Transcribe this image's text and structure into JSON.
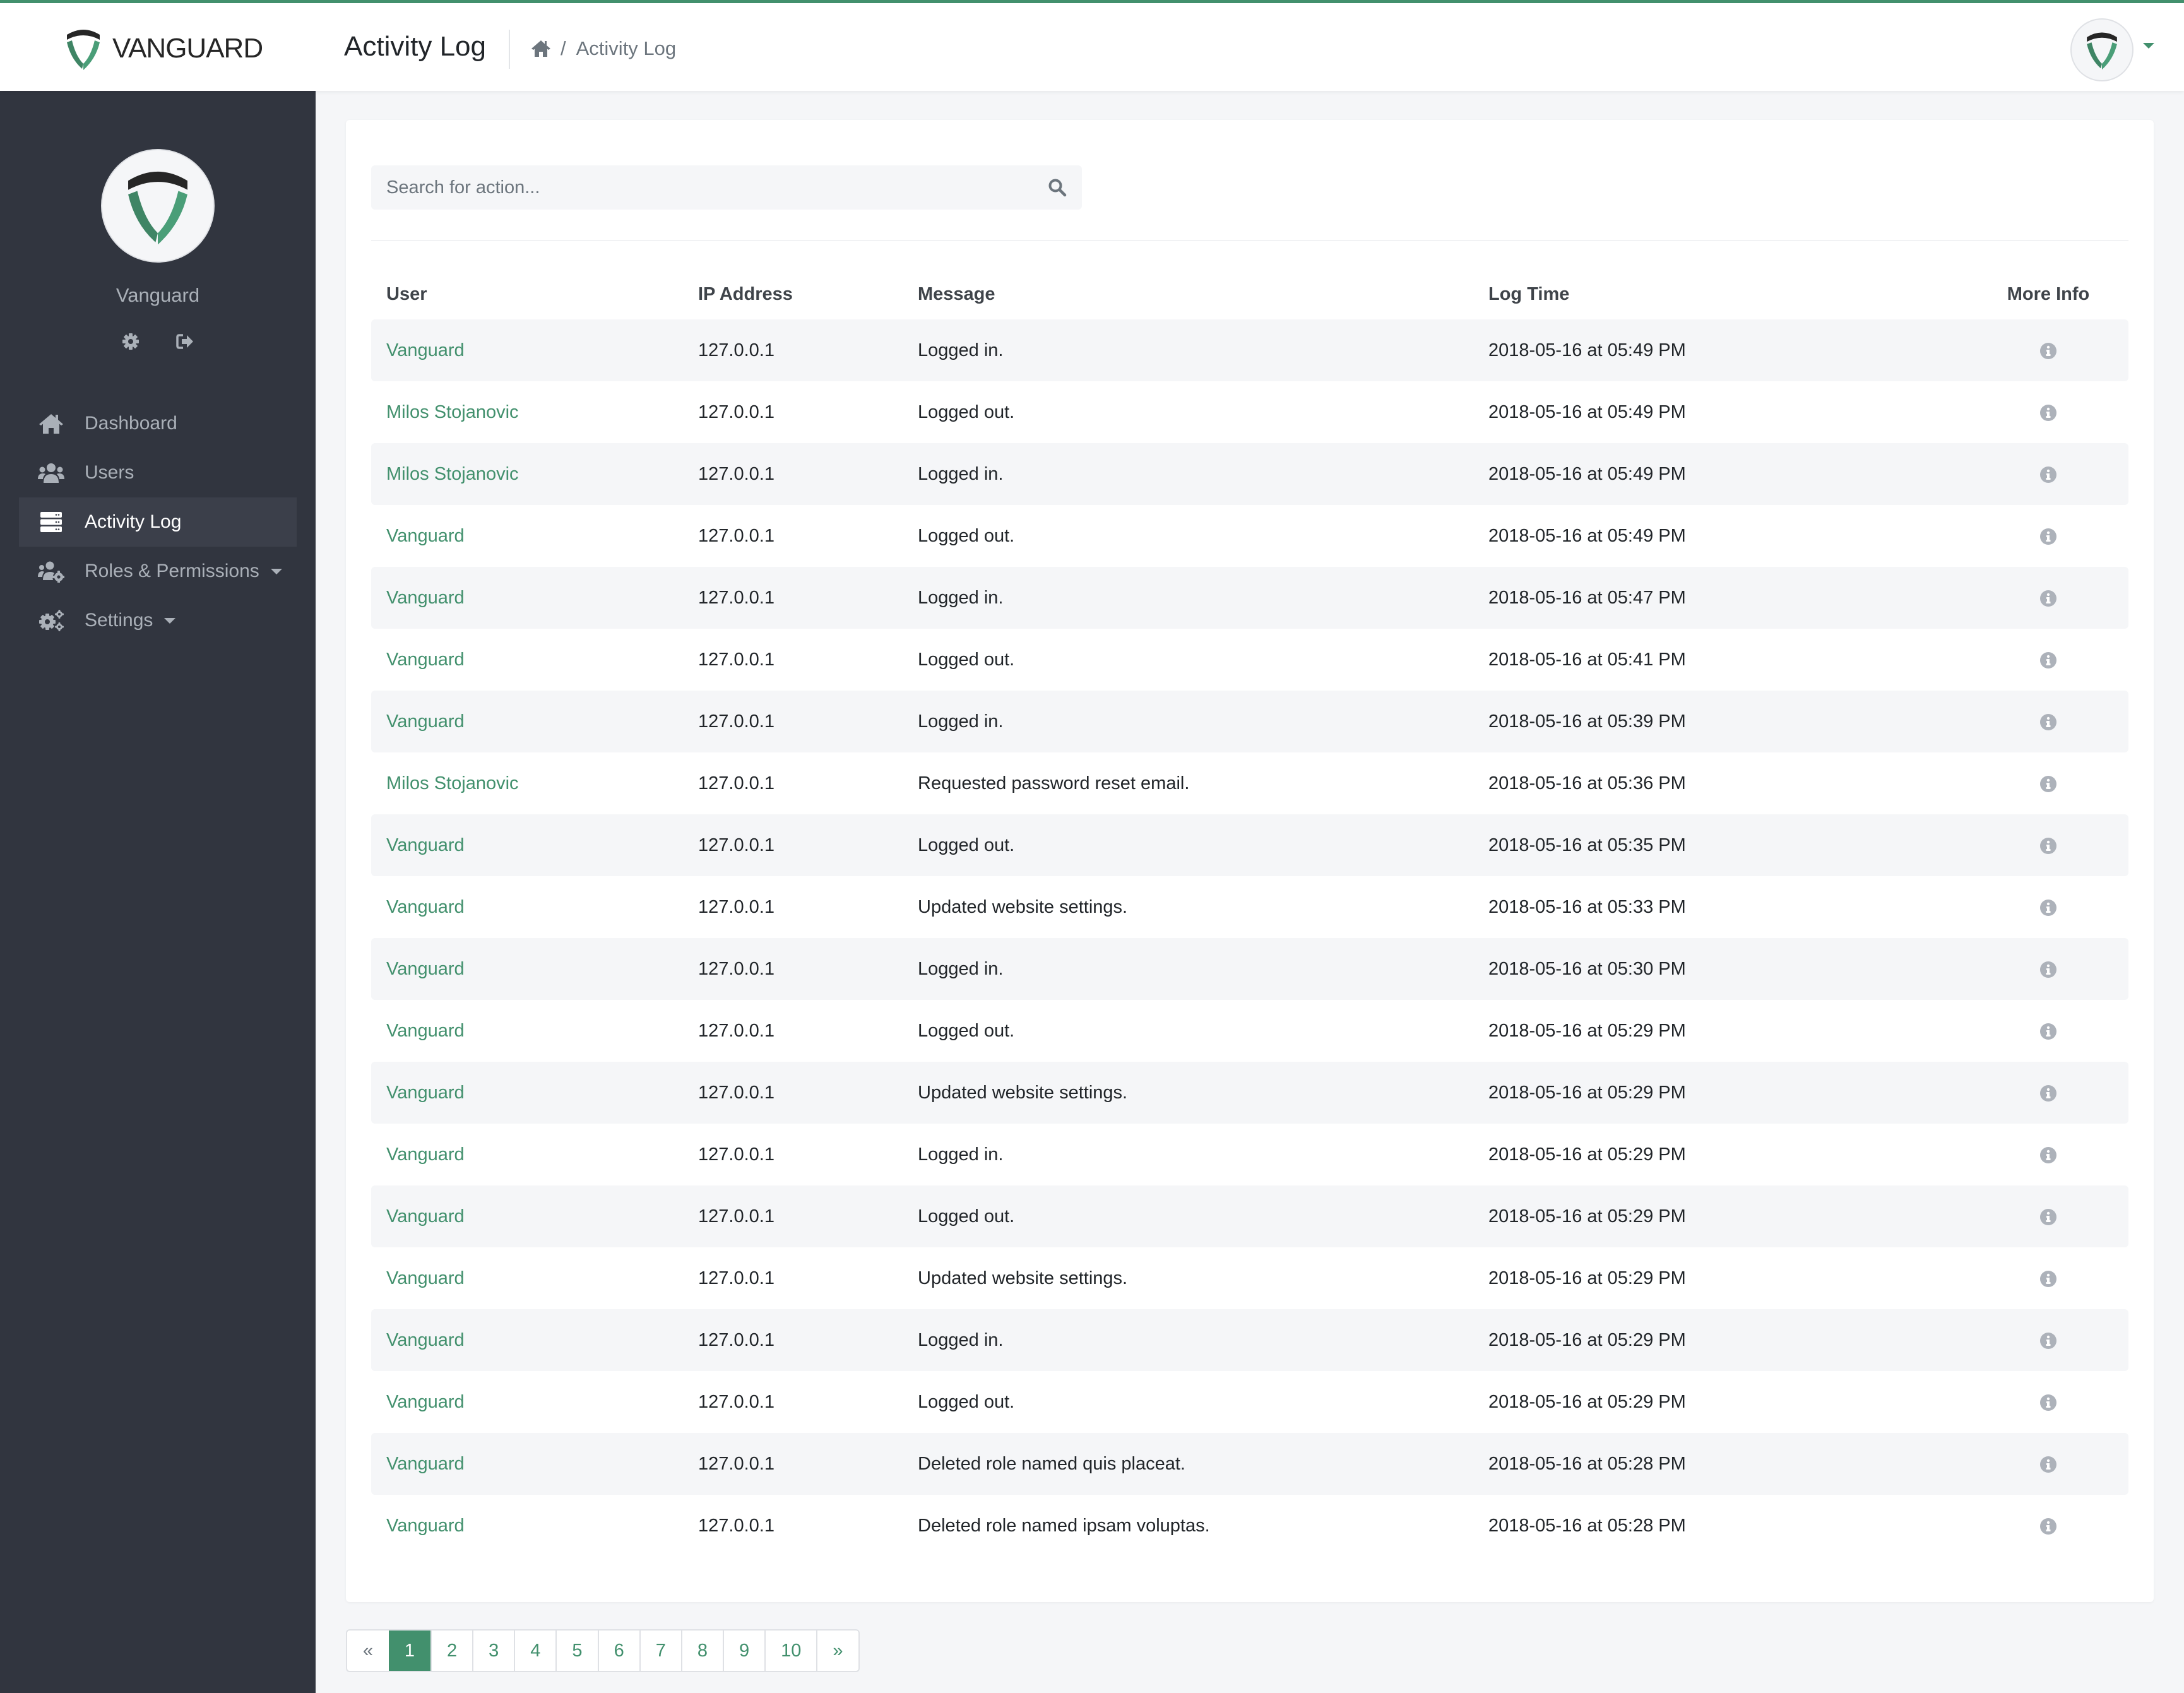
{
  "app": {
    "brand": "VANGUARD",
    "accent_color": "#42906d",
    "sidebar_color": "#31353f"
  },
  "header": {
    "title": "Activity Log",
    "breadcrumb": {
      "home_icon": "home-icon",
      "separator": "/",
      "current": "Activity Log"
    },
    "user_menu": {
      "avatar_icon": "vanguard-logo-icon",
      "caret_icon": "caret-down-icon"
    }
  },
  "sidebar": {
    "profile": {
      "name": "Vanguard",
      "settings_icon": "gear-icon",
      "logout_icon": "sign-out-icon"
    },
    "items": [
      {
        "label": "Dashboard",
        "icon": "home-icon",
        "active": false,
        "has_submenu": false
      },
      {
        "label": "Users",
        "icon": "users-icon",
        "active": false,
        "has_submenu": false
      },
      {
        "label": "Activity Log",
        "icon": "server-icon",
        "active": true,
        "has_submenu": false
      },
      {
        "label": "Roles & Permissions",
        "icon": "users-cog-icon",
        "active": false,
        "has_submenu": true
      },
      {
        "label": "Settings",
        "icon": "cogs-icon",
        "active": false,
        "has_submenu": true
      }
    ]
  },
  "search": {
    "placeholder": "Search for action...",
    "value": "",
    "icon": "search-icon"
  },
  "table": {
    "columns": [
      "User",
      "IP Address",
      "Message",
      "Log Time",
      "More Info"
    ],
    "rows": [
      {
        "user": "Vanguard",
        "ip": "127.0.0.1",
        "message": "Logged in.",
        "time": "2018-05-16 at 05:49 PM"
      },
      {
        "user": "Milos Stojanovic",
        "ip": "127.0.0.1",
        "message": "Logged out.",
        "time": "2018-05-16 at 05:49 PM"
      },
      {
        "user": "Milos Stojanovic",
        "ip": "127.0.0.1",
        "message": "Logged in.",
        "time": "2018-05-16 at 05:49 PM"
      },
      {
        "user": "Vanguard",
        "ip": "127.0.0.1",
        "message": "Logged out.",
        "time": "2018-05-16 at 05:49 PM"
      },
      {
        "user": "Vanguard",
        "ip": "127.0.0.1",
        "message": "Logged in.",
        "time": "2018-05-16 at 05:47 PM"
      },
      {
        "user": "Vanguard",
        "ip": "127.0.0.1",
        "message": "Logged out.",
        "time": "2018-05-16 at 05:41 PM"
      },
      {
        "user": "Vanguard",
        "ip": "127.0.0.1",
        "message": "Logged in.",
        "time": "2018-05-16 at 05:39 PM"
      },
      {
        "user": "Milos Stojanovic",
        "ip": "127.0.0.1",
        "message": "Requested password reset email.",
        "time": "2018-05-16 at 05:36 PM"
      },
      {
        "user": "Vanguard",
        "ip": "127.0.0.1",
        "message": "Logged out.",
        "time": "2018-05-16 at 05:35 PM"
      },
      {
        "user": "Vanguard",
        "ip": "127.0.0.1",
        "message": "Updated website settings.",
        "time": "2018-05-16 at 05:33 PM"
      },
      {
        "user": "Vanguard",
        "ip": "127.0.0.1",
        "message": "Logged in.",
        "time": "2018-05-16 at 05:30 PM"
      },
      {
        "user": "Vanguard",
        "ip": "127.0.0.1",
        "message": "Logged out.",
        "time": "2018-05-16 at 05:29 PM"
      },
      {
        "user": "Vanguard",
        "ip": "127.0.0.1",
        "message": "Updated website settings.",
        "time": "2018-05-16 at 05:29 PM"
      },
      {
        "user": "Vanguard",
        "ip": "127.0.0.1",
        "message": "Logged in.",
        "time": "2018-05-16 at 05:29 PM"
      },
      {
        "user": "Vanguard",
        "ip": "127.0.0.1",
        "message": "Logged out.",
        "time": "2018-05-16 at 05:29 PM"
      },
      {
        "user": "Vanguard",
        "ip": "127.0.0.1",
        "message": "Updated website settings.",
        "time": "2018-05-16 at 05:29 PM"
      },
      {
        "user": "Vanguard",
        "ip": "127.0.0.1",
        "message": "Logged in.",
        "time": "2018-05-16 at 05:29 PM"
      },
      {
        "user": "Vanguard",
        "ip": "127.0.0.1",
        "message": "Logged out.",
        "time": "2018-05-16 at 05:29 PM"
      },
      {
        "user": "Vanguard",
        "ip": "127.0.0.1",
        "message": "Deleted role named quis placeat.",
        "time": "2018-05-16 at 05:28 PM"
      },
      {
        "user": "Vanguard",
        "ip": "127.0.0.1",
        "message": "Deleted role named ipsam voluptas.",
        "time": "2018-05-16 at 05:28 PM"
      }
    ],
    "info_icon": "info-circle-icon"
  },
  "pagination": {
    "prev": "«",
    "next": "»",
    "pages": [
      "1",
      "2",
      "3",
      "4",
      "5",
      "6",
      "7",
      "8",
      "9",
      "10"
    ],
    "current": "1"
  }
}
